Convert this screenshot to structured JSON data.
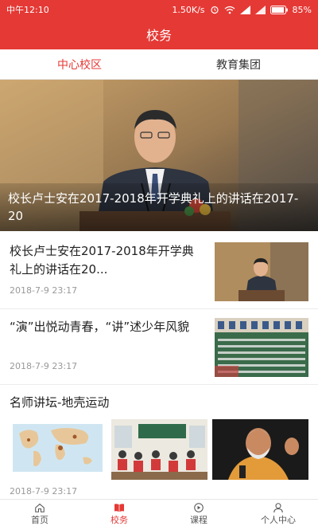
{
  "status_bar": {
    "time": "中午12:10",
    "network_speed": "1.50K/s",
    "battery": "85%",
    "icons": [
      "alarm-icon",
      "wifi-icon",
      "signal-icon",
      "signal-icon",
      "battery-icon"
    ]
  },
  "header": {
    "title": "校务"
  },
  "tabs": [
    {
      "label": "中心校区",
      "active": true
    },
    {
      "label": "教育集团",
      "active": false
    }
  ],
  "hero": {
    "caption": "校长卢士安在2017-2018年开学典礼上的讲话在2017-20"
  },
  "news": [
    {
      "title": "校长卢士安在2017-2018年开学典礼上的讲话在20...",
      "date": "2018-7-9 23:17"
    },
    {
      "title": "“演”出悦动青春，“讲”述少年风貌",
      "date": "2018-7-9 23:17"
    }
  ],
  "gallery": {
    "title": "名师讲坛-地壳运动",
    "date": "2018-7-9 23:17"
  },
  "bottom_nav": [
    {
      "label": "首页",
      "icon": "home-icon",
      "active": false
    },
    {
      "label": "校务",
      "icon": "book-icon",
      "active": true
    },
    {
      "label": "课程",
      "icon": "play-icon",
      "active": false
    },
    {
      "label": "个人中心",
      "icon": "user-icon",
      "active": false
    }
  ],
  "colors": {
    "accent": "#e53935",
    "text": "#222222",
    "muted": "#999999"
  }
}
